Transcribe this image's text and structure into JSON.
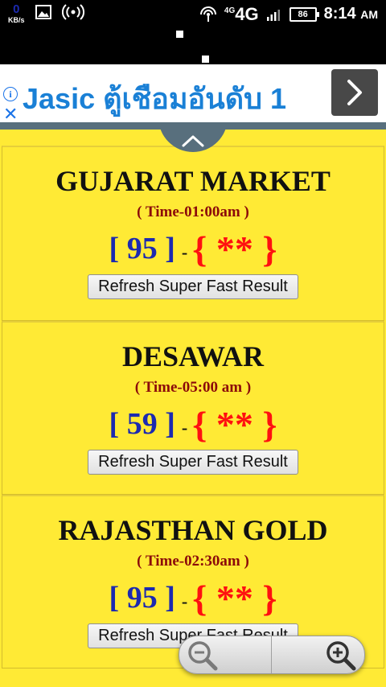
{
  "status_bar": {
    "speed_value": "0",
    "speed_unit": "KB/s",
    "network_small": "4G",
    "network_big": "4G",
    "battery": "86",
    "time": "8:14",
    "ampm": "AM"
  },
  "ad": {
    "info_glyph": "i",
    "close_glyph": "✕",
    "text": "Jasic ตู้เชือมอันดับ 1"
  },
  "markets": [
    {
      "title": "GUJARAT MARKET",
      "time": "( Time-01:00am )",
      "result": "[ 95 ]",
      "separator": "-",
      "stars": "{ ** }",
      "refresh_label": "Refresh Super Fast Result"
    },
    {
      "title": "DESAWAR",
      "time": "( Time-05:00 am )",
      "result": "[ 59 ]",
      "separator": "-",
      "stars": "{ ** }",
      "refresh_label": "Refresh Super Fast Result"
    },
    {
      "title": "RAJASTHAN GOLD",
      "time": "( Time-02:30am )",
      "result": "[ 95 ]",
      "separator": "-",
      "stars": "{ ** }",
      "refresh_label": "Refresh Super Fast Result"
    }
  ],
  "colors": {
    "page_background": "#ffea35",
    "ad_text": "#1a80d6",
    "result_number": "#1c2ab0",
    "stars": "#ff1010",
    "time_text": "#8b0a0a"
  }
}
